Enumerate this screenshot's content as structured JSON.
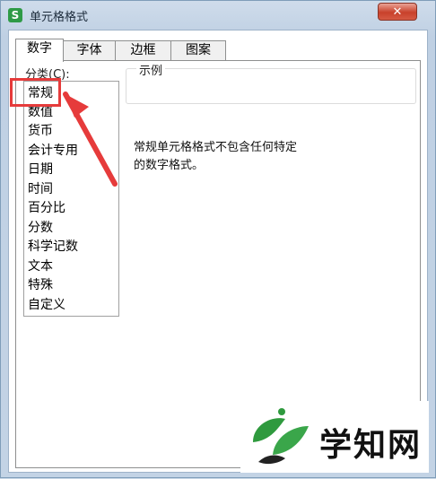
{
  "window": {
    "title": "单元格格式",
    "app_icon_glyph": "S",
    "close_glyph": "✕"
  },
  "tabs": [
    {
      "label": "数字",
      "active": true
    },
    {
      "label": "字体",
      "active": false
    },
    {
      "label": "边框",
      "active": false
    },
    {
      "label": "图案",
      "active": false
    }
  ],
  "category": {
    "label": "分类(C):",
    "items": [
      "常规",
      "数值",
      "货币",
      "会计专用",
      "日期",
      "时间",
      "百分比",
      "分数",
      "科学记数",
      "文本",
      "特殊",
      "自定义"
    ],
    "selected": "常规"
  },
  "sample": {
    "legend": "示例"
  },
  "description": {
    "line1": "常规单元格格式不包含任何特定",
    "line2": "的数字格式。"
  },
  "watermark": {
    "text": "学知网"
  },
  "colors": {
    "highlight": "#e63b3b",
    "logo_green": "#2f9a3e"
  }
}
